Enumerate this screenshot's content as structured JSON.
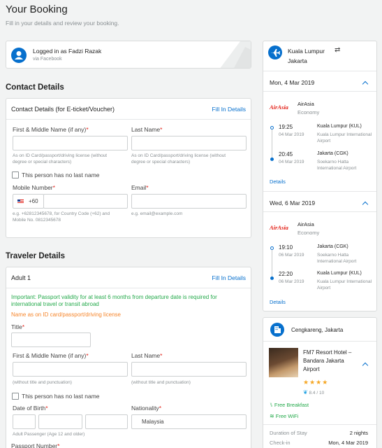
{
  "header": {
    "title": "Your Booking",
    "subtitle": "Fill in your details and review your booking."
  },
  "login": {
    "logged_in_as": "Logged in as Fadzi Razak",
    "via": "via Facebook"
  },
  "contact": {
    "section_title": "Contact Details",
    "card_title": "Contact Details (for E-ticket/Voucher)",
    "fill_in_link": "Fill In Details",
    "first_name_label": "First & Middle Name (if any)",
    "last_name_label": "Last Name",
    "first_name_hint": "As on ID Card/passport/driving license (without degree or special characters)",
    "last_name_hint": "As on ID Card/passport/driving license (without degree or special characters)",
    "no_last_name": "This person has no last name",
    "mobile_label": "Mobile Number",
    "country_code": "+60",
    "mobile_hint": "e.g. +62812345678, for Country Code (+62) and Mobile No. 0812345678",
    "email_label": "Email",
    "email_hint": "e.g. email@example.com",
    "required_mark": "*"
  },
  "traveler": {
    "section_title": "Traveler Details",
    "card_title": "Adult 1",
    "fill_in_link": "Fill In Details",
    "notice": "Important: Passport validity for at least 6 months from departure date is required for international travel or transit abroad",
    "name_note": "Name as on ID card/passport/driving license",
    "title_label": "Title",
    "first_name_label": "First & Middle Name (if any)",
    "last_name_label": "Last Name",
    "first_name_hint": "(without title and punctuation)",
    "last_name_hint": "(without title and punctuation)",
    "no_last_name": "This person has no last name",
    "dob_label": "Date of Birth",
    "dob_hint": "Adult Passenger (Age 12 and older)",
    "nationality_label": "Nationality",
    "nationality_value": "Malaysia",
    "passport_label": "Passport Number",
    "required_mark": "*"
  },
  "flight_summary": {
    "origin": "Kuala Lumpur",
    "destination": "Jakarta",
    "details_link": "Details",
    "legs": [
      {
        "date": "Mon, 4 Mar 2019",
        "airline_logo": "AirAsia",
        "airline": "AirAsia",
        "cabin": "Economy",
        "dep_time": "19:25",
        "dep_date": "04 Mar 2019",
        "dep_place": "Kuala Lumpur (KUL)",
        "dep_airport": "Kuala Lumpur International Airport",
        "arr_time": "20:45",
        "arr_date": "04 Mar 2019",
        "arr_place": "Jakarta (CGK)",
        "arr_airport": "Soekarno Hatta International Airport"
      },
      {
        "date": "Wed, 6 Mar 2019",
        "airline_logo": "AirAsia",
        "airline": "AirAsia",
        "cabin": "Economy",
        "dep_time": "19:10",
        "dep_date": "06 Mar 2019",
        "dep_place": "Jakarta (CGK)",
        "dep_airport": "Soekarno Hatta International Airport",
        "arr_time": "22:20",
        "arr_date": "06 Mar 2019",
        "arr_place": "Kuala Lumpur (KUL)",
        "arr_airport": "Kuala Lumpur International Airport"
      }
    ]
  },
  "hotel_summary": {
    "location": "Cengkareng, Jakarta",
    "name": "FM7 Resort Hotel – Bandara Jakarta Airport",
    "stars": 4,
    "rating": "8.4",
    "rating_suffix": "/ 10",
    "amenities": [
      "Free Breakfast",
      "Free WiFi"
    ],
    "duration_label": "Duration of Stay",
    "duration_value": "2 nights",
    "checkin_label": "Check-in",
    "checkin_value": "Mon, 4 Mar 2019"
  },
  "colors": {
    "accent_blue": "#0770cd",
    "required_red": "#e3231a",
    "warning_orange": "#f6862c",
    "success_green": "#23a94a",
    "page_bg": "#f2f3f3"
  }
}
